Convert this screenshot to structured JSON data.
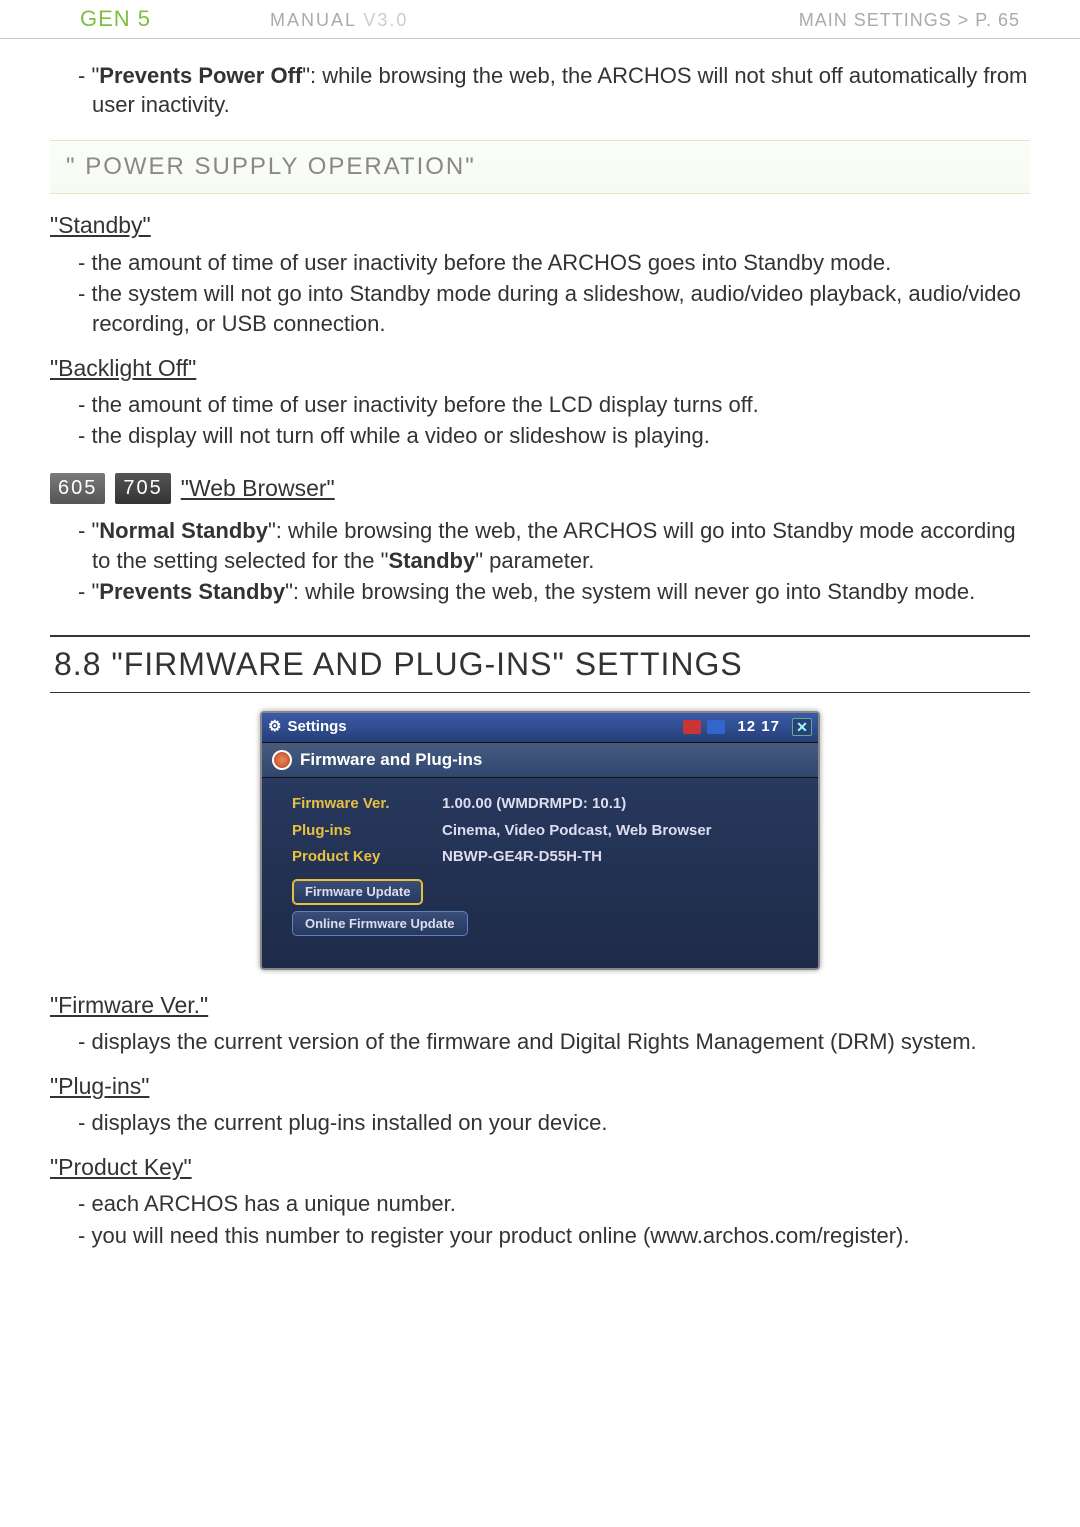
{
  "header": {
    "left": "GEN 5",
    "mid_label": "MANUAL",
    "mid_ver": "V3.0",
    "right": "MAIN SETTINGS   >   P. 65"
  },
  "intro_item": {
    "pre": "\"",
    "bold": "Prevents Power Off",
    "post": "\": while browsing the web, the ARCHOS will not shut off automatically from user inactivity."
  },
  "section_power_title": "\" POWER SUPPLY OPERATION\"",
  "standby": {
    "title": "\"Standby\"",
    "items": [
      "the amount of time of user inactivity before the ARCHOS goes into Standby mode.",
      "the system will not go into Standby mode during a slideshow, audio/video playback, audio/video recording, or USB connection."
    ]
  },
  "backlight": {
    "title": "\"Backlight Off\"",
    "items": [
      "the amount of time of user inactivity before the LCD display turns off.",
      "the display will not turn off while a video or slideshow is playing."
    ]
  },
  "webbrowser": {
    "badges": [
      "605",
      "705"
    ],
    "title": "\"Web Browser\"",
    "items": [
      {
        "bold": "Normal Standby",
        "text": "\": while browsing the web, the ARCHOS will go into Standby mode according to the setting selected for the \"",
        "bold2": "Standby",
        "tail": "\" parameter."
      },
      {
        "bold": "Prevents Standby",
        "text": "\": while browsing the web, the system will never go into Standby mode."
      }
    ]
  },
  "h2": "8.8  \"FIRMWARE AND PLUG-INS\" SETTINGS",
  "panel": {
    "window_title": "Settings",
    "clock": "12 17",
    "subtitle": "Firmware and Plug-ins",
    "rows": {
      "fw_label": "Firmware Ver.",
      "fw_val": "1.00.00     (WMDRMPD: 10.1)",
      "pl_label": "Plug-ins",
      "pl_val": "Cinema, Video Podcast, Web Browser",
      "pk_label": "Product Key",
      "pk_val": "NBWP-GE4R-D55H-TH"
    },
    "btn1": "Firmware Update",
    "btn2": "Online Firmware Update"
  },
  "fw_section": {
    "title": "\"Firmware Ver.\"",
    "item": "displays the current version of the firmware and Digital Rights Management (DRM) system."
  },
  "plugins_section": {
    "title": "\"Plug-ins\"",
    "item": "displays the current plug-ins installed on your device."
  },
  "pk_section": {
    "title": "\"Product Key\"",
    "items": [
      "each ARCHOS has a unique number.",
      "you will need this number to register your product online (www.archos.com/register)."
    ]
  }
}
